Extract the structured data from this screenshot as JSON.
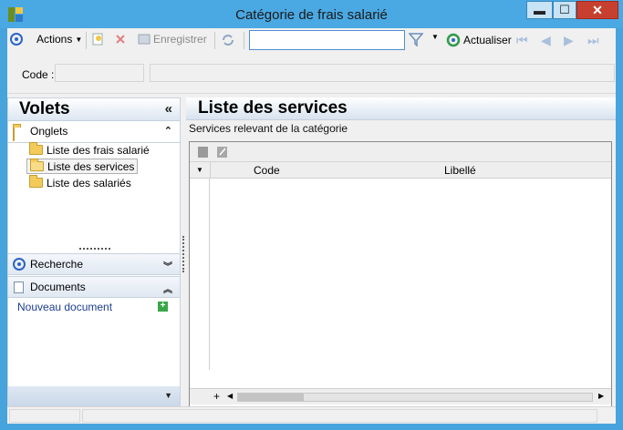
{
  "window": {
    "title": "Catégorie de frais salarié",
    "min_glyph": "▬",
    "max_glyph": "☐",
    "close_glyph": "✕"
  },
  "toolbar": {
    "actions_label": "Actions",
    "save_label": "Enregistrer",
    "search_value": "",
    "refresh_label": "Actualiser",
    "nav_first": "⏮",
    "nav_prev": "◀",
    "nav_next": "▶",
    "nav_last": "⏭"
  },
  "code_row": {
    "label": "Code :",
    "value": ""
  },
  "volets": {
    "title": "Volets",
    "collapse_glyph": "«",
    "onglets": {
      "label": "Onglets",
      "items": [
        "Liste des frais salarié",
        "Liste des services",
        "Liste des salariés"
      ],
      "selected": 1
    },
    "recherche": {
      "label": "Recherche"
    },
    "documents": {
      "label": "Documents",
      "new_doc": "Nouveau document"
    }
  },
  "list": {
    "title": "Liste des services",
    "subtitle": "Services relevant de la catégorie",
    "columns": [
      "Code",
      "Libellé"
    ],
    "add_row": "+"
  },
  "colors": {
    "title_bar": "#4aa8e2",
    "accent": "#2c64c8",
    "close": "#c7402f"
  }
}
